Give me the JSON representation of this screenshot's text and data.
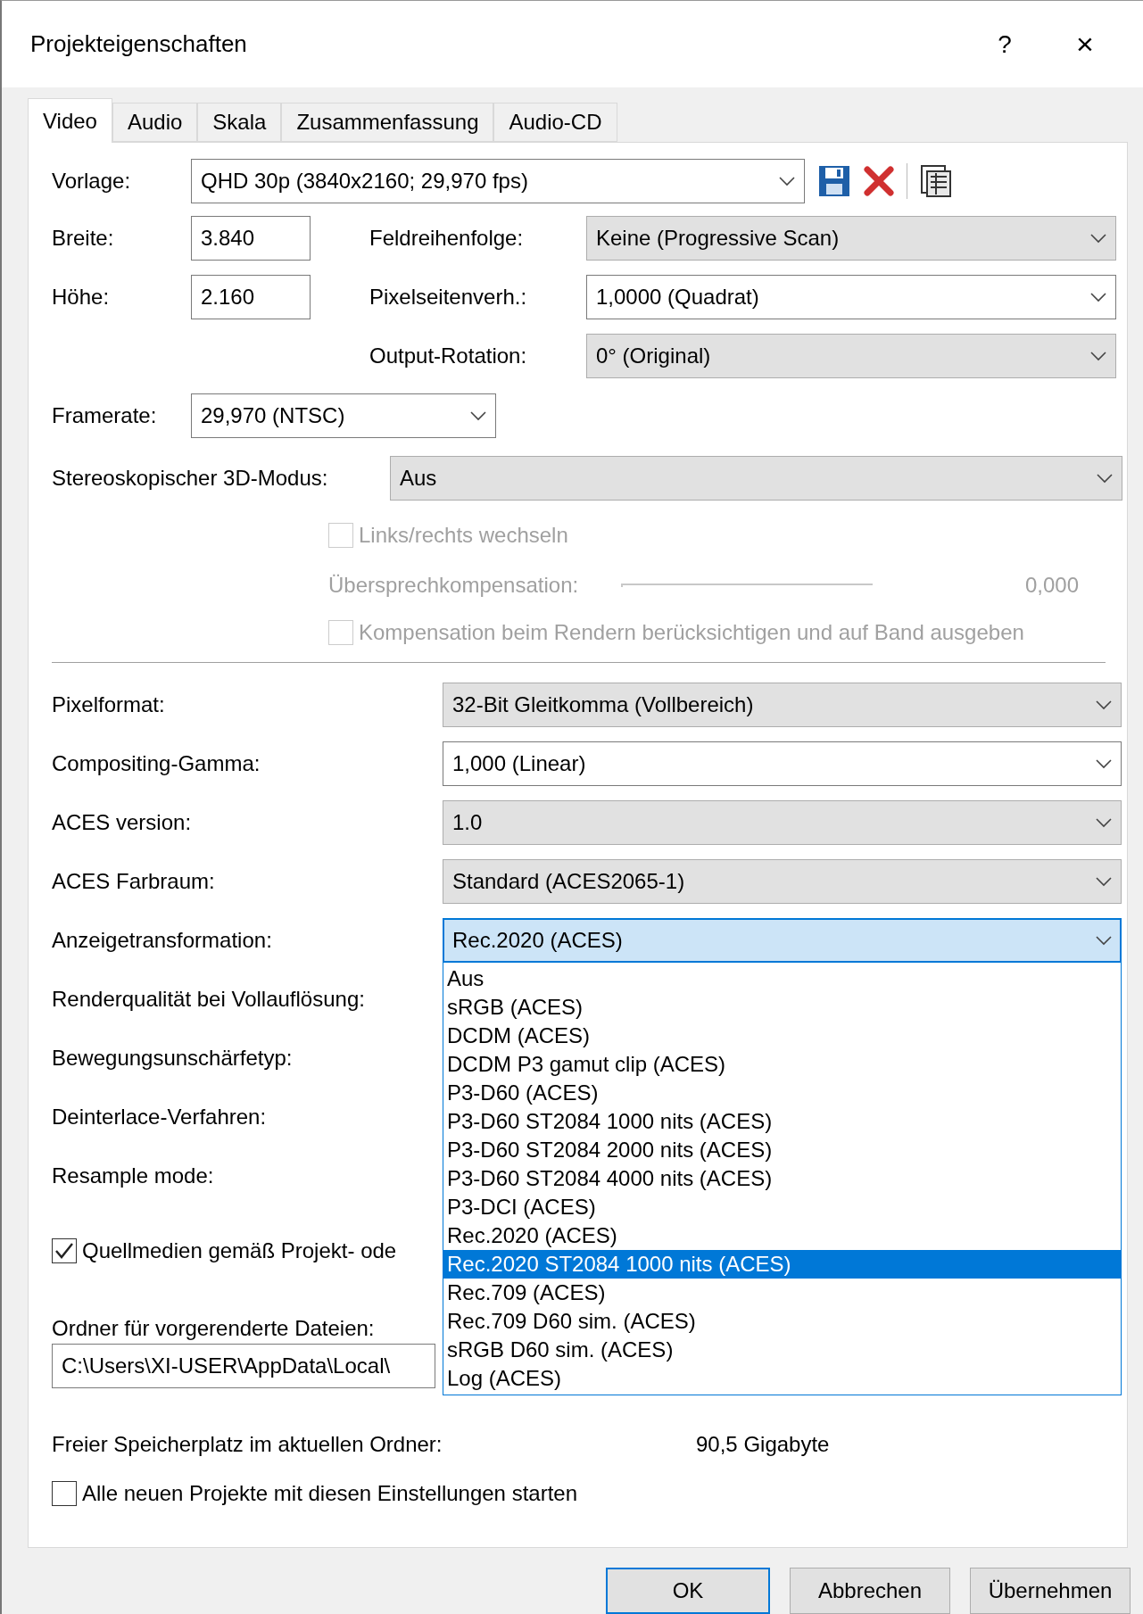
{
  "window": {
    "title": "Projekteigenschaften",
    "help": "?",
    "close": "×"
  },
  "tabs": [
    {
      "label": "Video",
      "selected": true
    },
    {
      "label": "Audio",
      "selected": false
    },
    {
      "label": "Skala",
      "selected": false
    },
    {
      "label": "Zusammenfassung",
      "selected": false
    },
    {
      "label": "Audio-CD",
      "selected": false
    }
  ],
  "template": {
    "label": "Vorlage:",
    "value": "QHD 30p (3840x2160; 29,970 fps)",
    "kind": "editable"
  },
  "width": {
    "label": "Breite:",
    "value": "3.840"
  },
  "height": {
    "label": "Höhe:",
    "value": "2.160"
  },
  "right_fields": [
    {
      "label": "Feldreihenfolge:",
      "value": "Keine (Progressive Scan)",
      "kind": "readonly"
    },
    {
      "label": "Pixelseitenverh.:",
      "value": "1,0000 (Quadrat)",
      "kind": "editable"
    },
    {
      "label": "Output-Rotation:",
      "value": "0° (Original)",
      "kind": "readonly"
    }
  ],
  "framerate": {
    "label": "Framerate:",
    "value": "29,970 (NTSC)",
    "kind": "editable"
  },
  "stereo": {
    "label": "Stereoskopischer 3D-Modus:",
    "value": "Aus",
    "kind": "readonly"
  },
  "swap": {
    "label": "Links/rechts wechseln",
    "checked": false,
    "disabled": true
  },
  "crosstalk": {
    "label": "Übersprechkompensation:",
    "reading": "0,000",
    "disabled": true
  },
  "render_comp": {
    "label": "Kompensation beim Rendern berücksichtigen und auf Band ausgeben",
    "checked": false,
    "disabled": true
  },
  "lower_fields": [
    {
      "label": "Pixelformat:",
      "value": "32-Bit Gleitkomma (Vollbereich)",
      "kind": "readonly"
    },
    {
      "label": "Compositing-Gamma:",
      "value": "1,000 (Linear)",
      "kind": "editable"
    },
    {
      "label": "ACES version:",
      "value": "1.0",
      "kind": "readonly"
    },
    {
      "label": "ACES Farbraum:",
      "value": "Standard (ACES2065-1)",
      "kind": "readonly"
    },
    {
      "label": "Anzeigetransformation:",
      "value": "Rec.2020 (ACES)",
      "kind": "focused",
      "expanded": true
    },
    {
      "label": "Renderqualität bei Vollauflösung:",
      "kind": "hidden"
    },
    {
      "label": "Bewegungsunschärfetyp:",
      "kind": "hidden"
    },
    {
      "label": "Deinterlace-Verfahren:",
      "kind": "hidden"
    },
    {
      "label": "Resample mode:",
      "kind": "hidden"
    }
  ],
  "dropdown_options": [
    {
      "label": "Aus",
      "selected": false
    },
    {
      "label": "sRGB (ACES)",
      "selected": false
    },
    {
      "label": "DCDM (ACES)",
      "selected": false
    },
    {
      "label": "DCDM P3 gamut clip (ACES)",
      "selected": false
    },
    {
      "label": "P3-D60 (ACES)",
      "selected": false
    },
    {
      "label": "P3-D60 ST2084 1000 nits (ACES)",
      "selected": false
    },
    {
      "label": "P3-D60 ST2084 2000 nits (ACES)",
      "selected": false
    },
    {
      "label": "P3-D60 ST2084 4000 nits (ACES)",
      "selected": false
    },
    {
      "label": "P3-DCI (ACES)",
      "selected": false
    },
    {
      "label": "Rec.2020 (ACES)",
      "selected": false
    },
    {
      "label": "Rec.2020 ST2084 1000 nits (ACES)",
      "selected": true
    },
    {
      "label": "Rec.709 (ACES)",
      "selected": false
    },
    {
      "label": "Rec.709 D60 sim. (ACES)",
      "selected": false
    },
    {
      "label": "sRGB D60 sim. (ACES)",
      "selected": false
    },
    {
      "label": "Log (ACES)",
      "selected": false
    }
  ],
  "source_media": {
    "label": "Quellmedien gemäß Projekt- ode",
    "checked": true
  },
  "prerender_folder": {
    "label": "Ordner für vorgerenderte Dateien:",
    "value": "C:\\Users\\XI-USER\\AppData\\Local\\"
  },
  "free_space": {
    "label": "Freier Speicherplatz im aktuellen Ordner:",
    "value": "90,5 Gigabyte"
  },
  "start_all": {
    "label": "Alle neuen Projekte mit diesen Einstellungen starten",
    "checked": false
  },
  "buttons": [
    {
      "label": "OK",
      "kind": "default"
    },
    {
      "label": "Abbrechen",
      "kind": "normal"
    },
    {
      "label": "Übernehmen",
      "kind": "normal"
    }
  ]
}
